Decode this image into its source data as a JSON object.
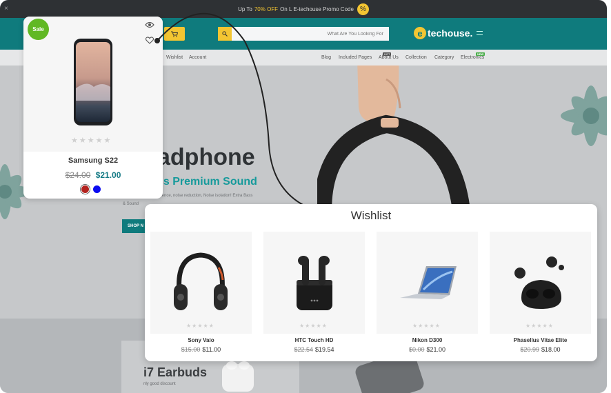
{
  "background_site": {
    "promo": {
      "close": "×",
      "text_prefix": "Up To",
      "highlight": "70% OFF",
      "text_suffix": "On L E-techouse Promo Code",
      "badge_symbol": "%"
    },
    "header": {
      "search_placeholder": "What Are You Looking For",
      "logo_letter": "e",
      "logo_text": "techouse."
    },
    "nav": {
      "left": [
        "Wishlist",
        "Account"
      ],
      "right": [
        "Blog",
        "Included Pages",
        "About Us",
        "Collection",
        "Category",
        "Electronics"
      ],
      "about_tag": "HOT",
      "electronics_tag": "NEW"
    },
    "hero": {
      "title": "adphone",
      "subtitle": "ss Premium Sound",
      "desc": "erience, noise reduction, Noise isolation! Extra Bass",
      "desc2": "& Sound",
      "shop_label": "SHOP N"
    },
    "lower": {
      "promo_title": "i7 Earbuds",
      "promo_desc": "nly good discount"
    }
  },
  "product_card": {
    "sale_label": "Sale",
    "name": "Samsung S22",
    "old_price": "$24.00",
    "price": "$21.00",
    "rating": 0,
    "stars": [
      "★",
      "★",
      "★",
      "★",
      "★"
    ],
    "swatches": [
      "#b3231f",
      "#0b0bf0"
    ],
    "icons": [
      "eye-icon",
      "heart-icon"
    ]
  },
  "wishlist": {
    "title": "Wishlist",
    "items": [
      {
        "name": "Sony Vaio",
        "old_price": "$15.00",
        "price": "$11.00",
        "rating": 0,
        "image": "headphones"
      },
      {
        "name": "HTC Touch HD",
        "old_price": "$22.54",
        "price": "$19.54",
        "rating": 0,
        "image": "earbuds-case"
      },
      {
        "name": "Nikon D300",
        "old_price": "$0.00",
        "price": "$21.00",
        "rating": 0,
        "image": "laptop"
      },
      {
        "name": "Phasellus Vitae Elite",
        "old_price": "$20.99",
        "price": "$18.00",
        "rating": 0,
        "image": "round-earbuds"
      }
    ],
    "stars": [
      "★",
      "★",
      "★",
      "★",
      "★"
    ]
  },
  "colors": {
    "teal": "#0f7b7d",
    "yellow": "#f3c532",
    "sale_green": "#61b824",
    "price_teal": "#157a85"
  }
}
